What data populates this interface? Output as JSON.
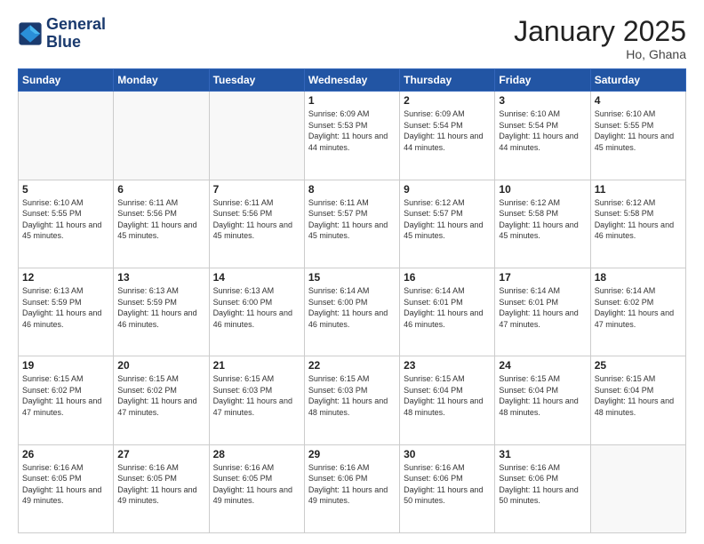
{
  "header": {
    "logo_line1": "General",
    "logo_line2": "Blue",
    "month": "January 2025",
    "location": "Ho, Ghana"
  },
  "weekdays": [
    "Sunday",
    "Monday",
    "Tuesday",
    "Wednesday",
    "Thursday",
    "Friday",
    "Saturday"
  ],
  "weeks": [
    [
      {
        "day": "",
        "sunrise": "",
        "sunset": "",
        "daylight": "",
        "empty": true
      },
      {
        "day": "",
        "sunrise": "",
        "sunset": "",
        "daylight": "",
        "empty": true
      },
      {
        "day": "",
        "sunrise": "",
        "sunset": "",
        "daylight": "",
        "empty": true
      },
      {
        "day": "1",
        "sunrise": "Sunrise: 6:09 AM",
        "sunset": "Sunset: 5:53 PM",
        "daylight": "Daylight: 11 hours and 44 minutes."
      },
      {
        "day": "2",
        "sunrise": "Sunrise: 6:09 AM",
        "sunset": "Sunset: 5:54 PM",
        "daylight": "Daylight: 11 hours and 44 minutes."
      },
      {
        "day": "3",
        "sunrise": "Sunrise: 6:10 AM",
        "sunset": "Sunset: 5:54 PM",
        "daylight": "Daylight: 11 hours and 44 minutes."
      },
      {
        "day": "4",
        "sunrise": "Sunrise: 6:10 AM",
        "sunset": "Sunset: 5:55 PM",
        "daylight": "Daylight: 11 hours and 45 minutes."
      }
    ],
    [
      {
        "day": "5",
        "sunrise": "Sunrise: 6:10 AM",
        "sunset": "Sunset: 5:55 PM",
        "daylight": "Daylight: 11 hours and 45 minutes."
      },
      {
        "day": "6",
        "sunrise": "Sunrise: 6:11 AM",
        "sunset": "Sunset: 5:56 PM",
        "daylight": "Daylight: 11 hours and 45 minutes."
      },
      {
        "day": "7",
        "sunrise": "Sunrise: 6:11 AM",
        "sunset": "Sunset: 5:56 PM",
        "daylight": "Daylight: 11 hours and 45 minutes."
      },
      {
        "day": "8",
        "sunrise": "Sunrise: 6:11 AM",
        "sunset": "Sunset: 5:57 PM",
        "daylight": "Daylight: 11 hours and 45 minutes."
      },
      {
        "day": "9",
        "sunrise": "Sunrise: 6:12 AM",
        "sunset": "Sunset: 5:57 PM",
        "daylight": "Daylight: 11 hours and 45 minutes."
      },
      {
        "day": "10",
        "sunrise": "Sunrise: 6:12 AM",
        "sunset": "Sunset: 5:58 PM",
        "daylight": "Daylight: 11 hours and 45 minutes."
      },
      {
        "day": "11",
        "sunrise": "Sunrise: 6:12 AM",
        "sunset": "Sunset: 5:58 PM",
        "daylight": "Daylight: 11 hours and 46 minutes."
      }
    ],
    [
      {
        "day": "12",
        "sunrise": "Sunrise: 6:13 AM",
        "sunset": "Sunset: 5:59 PM",
        "daylight": "Daylight: 11 hours and 46 minutes."
      },
      {
        "day": "13",
        "sunrise": "Sunrise: 6:13 AM",
        "sunset": "Sunset: 5:59 PM",
        "daylight": "Daylight: 11 hours and 46 minutes."
      },
      {
        "day": "14",
        "sunrise": "Sunrise: 6:13 AM",
        "sunset": "Sunset: 6:00 PM",
        "daylight": "Daylight: 11 hours and 46 minutes."
      },
      {
        "day": "15",
        "sunrise": "Sunrise: 6:14 AM",
        "sunset": "Sunset: 6:00 PM",
        "daylight": "Daylight: 11 hours and 46 minutes."
      },
      {
        "day": "16",
        "sunrise": "Sunrise: 6:14 AM",
        "sunset": "Sunset: 6:01 PM",
        "daylight": "Daylight: 11 hours and 46 minutes."
      },
      {
        "day": "17",
        "sunrise": "Sunrise: 6:14 AM",
        "sunset": "Sunset: 6:01 PM",
        "daylight": "Daylight: 11 hours and 47 minutes."
      },
      {
        "day": "18",
        "sunrise": "Sunrise: 6:14 AM",
        "sunset": "Sunset: 6:02 PM",
        "daylight": "Daylight: 11 hours and 47 minutes."
      }
    ],
    [
      {
        "day": "19",
        "sunrise": "Sunrise: 6:15 AM",
        "sunset": "Sunset: 6:02 PM",
        "daylight": "Daylight: 11 hours and 47 minutes."
      },
      {
        "day": "20",
        "sunrise": "Sunrise: 6:15 AM",
        "sunset": "Sunset: 6:02 PM",
        "daylight": "Daylight: 11 hours and 47 minutes."
      },
      {
        "day": "21",
        "sunrise": "Sunrise: 6:15 AM",
        "sunset": "Sunset: 6:03 PM",
        "daylight": "Daylight: 11 hours and 47 minutes."
      },
      {
        "day": "22",
        "sunrise": "Sunrise: 6:15 AM",
        "sunset": "Sunset: 6:03 PM",
        "daylight": "Daylight: 11 hours and 48 minutes."
      },
      {
        "day": "23",
        "sunrise": "Sunrise: 6:15 AM",
        "sunset": "Sunset: 6:04 PM",
        "daylight": "Daylight: 11 hours and 48 minutes."
      },
      {
        "day": "24",
        "sunrise": "Sunrise: 6:15 AM",
        "sunset": "Sunset: 6:04 PM",
        "daylight": "Daylight: 11 hours and 48 minutes."
      },
      {
        "day": "25",
        "sunrise": "Sunrise: 6:15 AM",
        "sunset": "Sunset: 6:04 PM",
        "daylight": "Daylight: 11 hours and 48 minutes."
      }
    ],
    [
      {
        "day": "26",
        "sunrise": "Sunrise: 6:16 AM",
        "sunset": "Sunset: 6:05 PM",
        "daylight": "Daylight: 11 hours and 49 minutes."
      },
      {
        "day": "27",
        "sunrise": "Sunrise: 6:16 AM",
        "sunset": "Sunset: 6:05 PM",
        "daylight": "Daylight: 11 hours and 49 minutes."
      },
      {
        "day": "28",
        "sunrise": "Sunrise: 6:16 AM",
        "sunset": "Sunset: 6:05 PM",
        "daylight": "Daylight: 11 hours and 49 minutes."
      },
      {
        "day": "29",
        "sunrise": "Sunrise: 6:16 AM",
        "sunset": "Sunset: 6:06 PM",
        "daylight": "Daylight: 11 hours and 49 minutes."
      },
      {
        "day": "30",
        "sunrise": "Sunrise: 6:16 AM",
        "sunset": "Sunset: 6:06 PM",
        "daylight": "Daylight: 11 hours and 50 minutes."
      },
      {
        "day": "31",
        "sunrise": "Sunrise: 6:16 AM",
        "sunset": "Sunset: 6:06 PM",
        "daylight": "Daylight: 11 hours and 50 minutes."
      },
      {
        "day": "",
        "sunrise": "",
        "sunset": "",
        "daylight": "",
        "empty": true
      }
    ]
  ]
}
